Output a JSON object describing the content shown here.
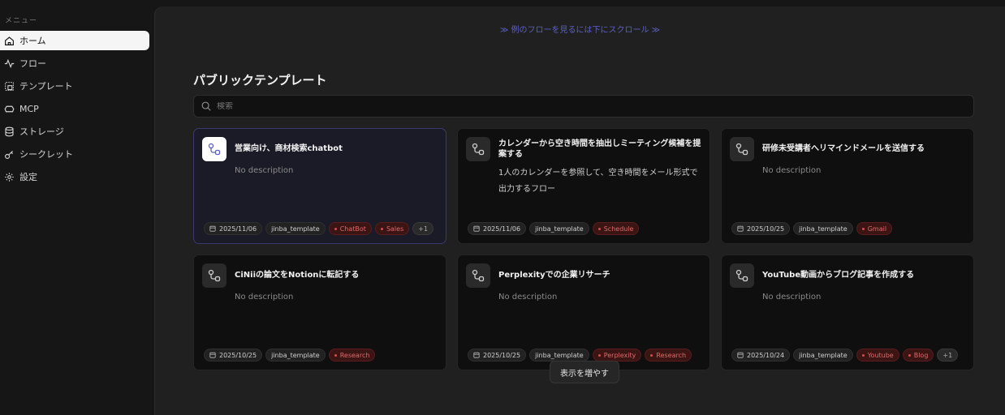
{
  "sidebar": {
    "caption": "メニュー",
    "items": [
      {
        "label": "ホーム",
        "icon": "home-icon",
        "active": true
      },
      {
        "label": "フロー",
        "icon": "activity-icon"
      },
      {
        "label": "テンプレート",
        "icon": "template-icon"
      },
      {
        "label": "MCP",
        "icon": "mcp-icon"
      },
      {
        "label": "ストレージ",
        "icon": "database-icon"
      },
      {
        "label": "シークレット",
        "icon": "key-icon"
      },
      {
        "label": "設定",
        "icon": "gear-icon"
      }
    ]
  },
  "main": {
    "scroll_hint": "≫ 例のフローを見るには下にスクロール ≫",
    "section_title": "パブリックテンプレート",
    "search": {
      "placeholder": "検索",
      "value": ""
    },
    "more_button": "表示を増やす",
    "colors": {
      "accent": "#5b5fc7",
      "tag_text": "#e06a6a",
      "tag_bg": "#3b1414"
    },
    "cards": [
      {
        "title": "営業向け、商材検索chatbot",
        "description": "No description",
        "date": "2025/11/06",
        "author": "jinba_template",
        "tags": [
          "ChatBot",
          "Sales"
        ],
        "more": "+1"
      },
      {
        "title": "カレンダーから空き時間を抽出しミーティング候補を提案する",
        "description": "1人のカレンダーを参照して、空き時間をメール形式で出力するフロー",
        "date": "2025/11/06",
        "author": "jinba_template",
        "tags": [
          "Schedule"
        ],
        "more": ""
      },
      {
        "title": "研修未受講者へリマインドメールを送信する",
        "description": "No description",
        "date": "2025/10/25",
        "author": "jinba_template",
        "tags": [
          "Gmail"
        ],
        "more": ""
      },
      {
        "title": "CiNiiの論文をNotionに転記する",
        "description": "No description",
        "date": "2025/10/25",
        "author": "jinba_template",
        "tags": [
          "Research"
        ],
        "more": ""
      },
      {
        "title": "Perplexityでの企業リサーチ",
        "description": "No description",
        "date": "2025/10/25",
        "author": "jinba_template",
        "tags": [
          "Perplexity",
          "Research"
        ],
        "more": ""
      },
      {
        "title": "YouTube動画からブログ記事を作成する",
        "description": "No description",
        "date": "2025/10/24",
        "author": "jinba_template",
        "tags": [
          "Youtube",
          "Blog"
        ],
        "more": "+1"
      }
    ]
  }
}
